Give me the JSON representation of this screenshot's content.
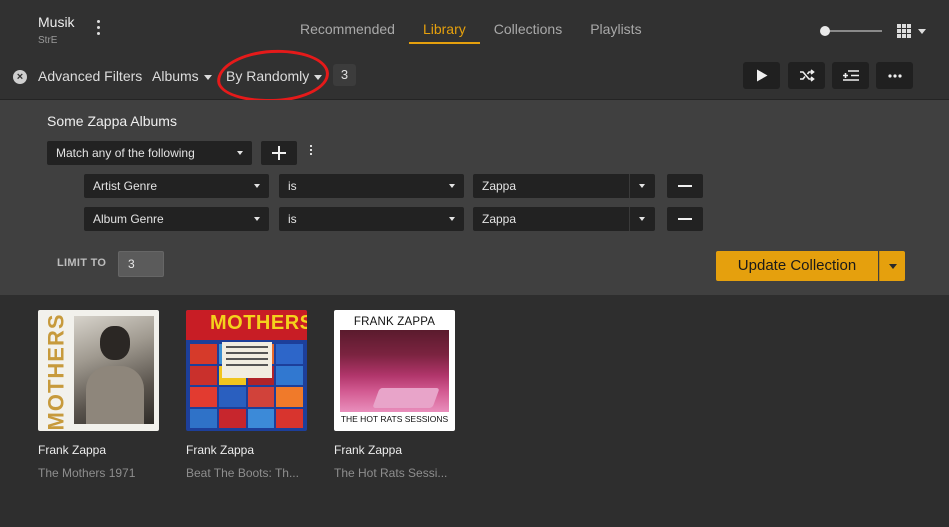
{
  "app": {
    "name": "Musik",
    "server": "StrE"
  },
  "nav": {
    "tabs": [
      "Recommended",
      "Library",
      "Collections",
      "Playlists"
    ],
    "active_tab": "Library"
  },
  "filterbar": {
    "advanced_filters_label": "Advanced Filters",
    "type_dropdown": "Albums",
    "sort_dropdown": "By Randomly",
    "item_count": "3"
  },
  "toolbar": {
    "buttons": [
      "play-icon",
      "shuffle-icon",
      "add-to-queue-icon",
      "more-icon"
    ]
  },
  "collection": {
    "name": "Some Zappa Albums",
    "match_mode": "Match any of the following",
    "rules": [
      {
        "field": "Artist Genre",
        "operator": "is",
        "value": "Zappa"
      },
      {
        "field": "Album Genre",
        "operator": "is",
        "value": "Zappa"
      }
    ],
    "limit_label": "LIMIT TO",
    "limit_value": "3",
    "update_button": "Update Collection"
  },
  "albums": [
    {
      "artist": "Frank Zappa",
      "title": "The Mothers 1971",
      "cover_text": "MOTHERS"
    },
    {
      "artist": "Frank Zappa",
      "title": "Beat The Boots: Th...",
      "cover_text": "MOTHERS"
    },
    {
      "artist": "Frank Zappa",
      "title": "The Hot Rats Sessi...",
      "cover_header": "FRANK ZAPPA",
      "cover_footer": "THE HOT RATS SESSIONS"
    }
  ],
  "colors": {
    "accent": "#e5a00d",
    "annotation": "#e51a1a",
    "background": "#2e2e2e",
    "panel": "#404040"
  }
}
